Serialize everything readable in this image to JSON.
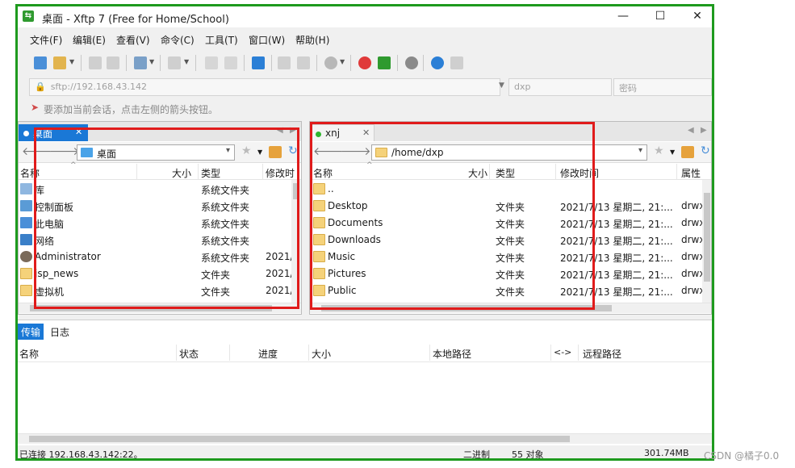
{
  "window": {
    "title": "桌面 - Xftp 7 (Free for Home/School)",
    "controls": {
      "minimize": "—",
      "maximize": "☐",
      "close": "✕"
    }
  },
  "menu": [
    "文件(F)",
    "编辑(E)",
    "查看(V)",
    "命令(C)",
    "工具(T)",
    "窗口(W)",
    "帮助(H)"
  ],
  "address": {
    "host": "sftp://192.168.43.142",
    "user": "dxp",
    "password_placeholder": "密码"
  },
  "hint": "要添加当前会话，点击左侧的箭头按钮。",
  "left_panel": {
    "tab": "桌面",
    "path": "桌面",
    "columns": [
      "名称",
      "大小",
      "类型",
      "修改时"
    ],
    "rows": [
      {
        "name": "库",
        "size": "",
        "type": "系统文件夹",
        "modified": ""
      },
      {
        "name": "控制面板",
        "size": "",
        "type": "系统文件夹",
        "modified": ""
      },
      {
        "name": "此电脑",
        "size": "",
        "type": "系统文件夹",
        "modified": ""
      },
      {
        "name": "网络",
        "size": "",
        "type": "系统文件夹",
        "modified": ""
      },
      {
        "name": "Administrator",
        "size": "",
        "type": "系统文件夹",
        "modified": "2021/"
      },
      {
        "name": "jsp_news",
        "size": "",
        "type": "文件夹",
        "modified": "2021/"
      },
      {
        "name": "虚拟机",
        "size": "",
        "type": "文件夹",
        "modified": "2021/"
      }
    ]
  },
  "right_panel": {
    "tab": "xnj",
    "path": "/home/dxp",
    "columns": [
      "名称",
      "大小",
      "类型",
      "修改时间",
      "属性"
    ],
    "rows": [
      {
        "name": "..",
        "size": "",
        "type": "",
        "modified": "",
        "attr": ""
      },
      {
        "name": "Desktop",
        "size": "",
        "type": "文件夹",
        "modified": "2021/7/13 星期二, 21:...",
        "attr": "drwx"
      },
      {
        "name": "Documents",
        "size": "",
        "type": "文件夹",
        "modified": "2021/7/13 星期二, 21:...",
        "attr": "drwx"
      },
      {
        "name": "Downloads",
        "size": "",
        "type": "文件夹",
        "modified": "2021/7/13 星期二, 21:...",
        "attr": "drwx"
      },
      {
        "name": "Music",
        "size": "",
        "type": "文件夹",
        "modified": "2021/7/13 星期二, 21:...",
        "attr": "drwx"
      },
      {
        "name": "Pictures",
        "size": "",
        "type": "文件夹",
        "modified": "2021/7/13 星期二, 21:...",
        "attr": "drwx"
      },
      {
        "name": "Public",
        "size": "",
        "type": "文件夹",
        "modified": "2021/7/13 星期二, 21:...",
        "attr": "drwx"
      }
    ]
  },
  "transfer": {
    "tabs": [
      "传输",
      "日志"
    ],
    "columns": [
      "名称",
      "状态",
      "进度",
      "大小",
      "本地路径",
      "<->",
      "远程路径"
    ]
  },
  "status": {
    "connection": "已连接 192.168.43.142:22。",
    "mode": "二进制",
    "objects": "55 对象",
    "size": "301.74MB"
  },
  "watermark": "CSDN @橘子0.0",
  "colors": {
    "frame_green": "#1e9a1e",
    "annotation_red": "#e01b1b",
    "folder": "#f5d27a",
    "active_tab": "#1a78d6"
  }
}
